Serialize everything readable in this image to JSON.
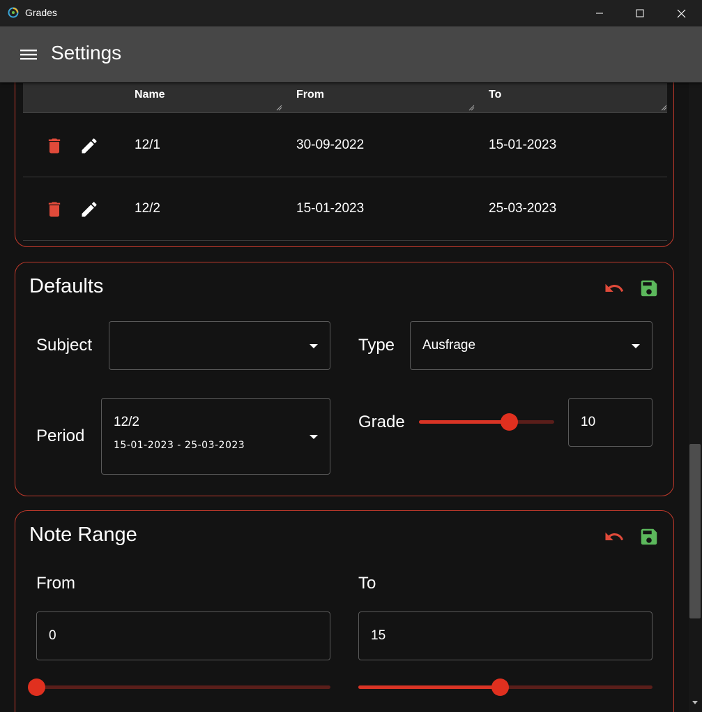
{
  "window": {
    "title": "Grades",
    "controls": [
      "minimize-icon",
      "maximize-icon",
      "close-icon"
    ]
  },
  "appbar": {
    "title": "Settings",
    "menu_icon": "menu-icon"
  },
  "periods": {
    "columns": [
      "Name",
      "From",
      "To"
    ],
    "rows": [
      {
        "name": "12/1",
        "from": "30-09-2022",
        "to": "15-01-2023"
      },
      {
        "name": "12/2",
        "from": "15-01-2023",
        "to": "25-03-2023"
      }
    ],
    "row_actions": [
      "delete-icon",
      "edit-icon"
    ]
  },
  "defaults": {
    "title": "Defaults",
    "subject_label": "Subject",
    "subject_value": "",
    "type_label": "Type",
    "type_value": "Ausfrage",
    "period_label": "Period",
    "period_value": "12/2",
    "period_range": "15-01-2023 - 25-03-2023",
    "grade_label": "Grade",
    "grade_value": "10",
    "grade_slider_fraction": 0.667,
    "actions": [
      "undo-icon",
      "save-icon"
    ]
  },
  "note_range": {
    "title": "Note Range",
    "from_label": "From",
    "from_value": "0",
    "to_label": "To",
    "to_value": "15",
    "from_slider_fraction": 0.0,
    "to_slider_fraction": 0.48,
    "actions": [
      "undo-icon",
      "save-icon"
    ]
  },
  "colors": {
    "accent_red": "#d93425",
    "save_green": "#5cb85c",
    "background": "#131313",
    "appbar": "#474747"
  }
}
